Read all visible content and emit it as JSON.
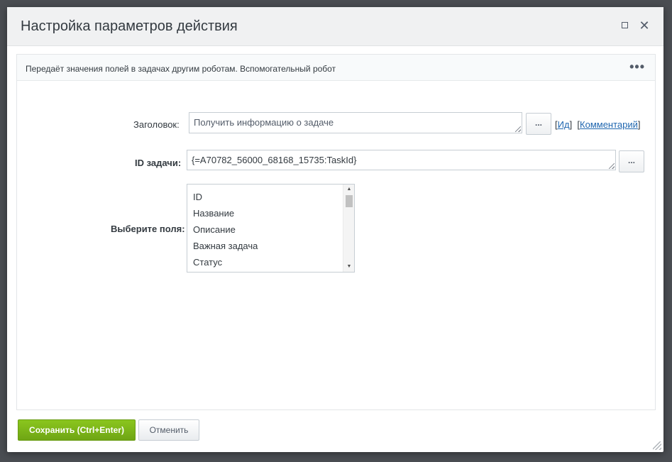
{
  "dialog": {
    "title": "Настройка параметров действия",
    "description": "Передаёт значения полей в задачах другим роботам. Вспомогательный робот",
    "menu_glyph": "•••"
  },
  "fields": {
    "title_label": "Заголовок:",
    "title_value": "Получить информацию о задаче",
    "title_dots": "...",
    "id_link": "Ид",
    "comment_link": "Комментарий",
    "task_id_label": "ID задачи:",
    "task_id_value": "{=A70782_56000_68168_15735:TaskId}",
    "task_id_dots": "...",
    "select_fields_label": "Выберите поля:",
    "select_options": [
      "ID",
      "Название",
      "Описание",
      "Важная задача",
      "Статус"
    ]
  },
  "footer": {
    "save_label": "Сохранить (Ctrl+Enter)",
    "cancel_label": "Отменить"
  },
  "colors": {
    "save_button": "#7ab51b",
    "link": "#2067b0",
    "titlebar": "#f0f1f2"
  }
}
